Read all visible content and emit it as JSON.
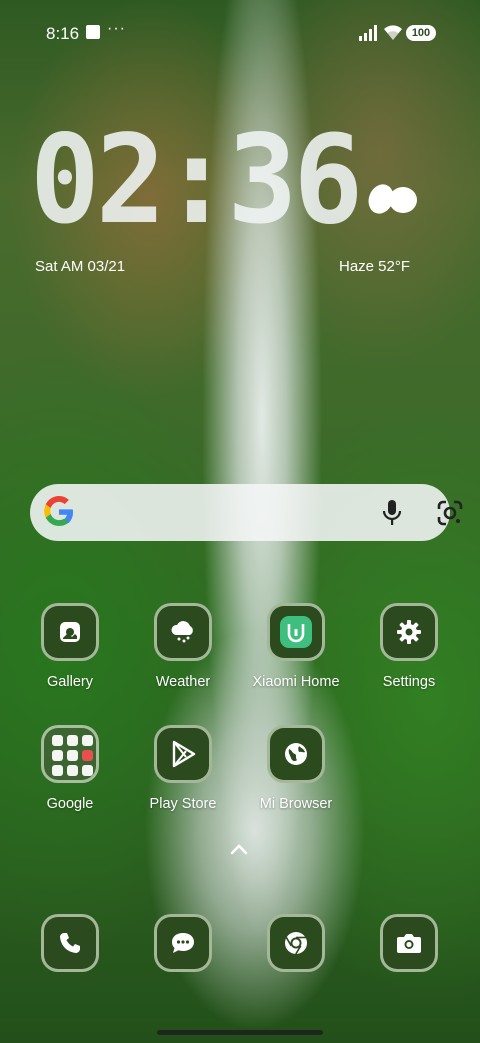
{
  "status_bar": {
    "time": "8:16",
    "overflow": "···",
    "battery": "100",
    "icons": [
      "notification-square-icon",
      "signal-icon",
      "wifi-icon",
      "battery-icon"
    ]
  },
  "clock_widget": {
    "time": "02:36",
    "date": "Sat AM 03/21",
    "weather": "Haze  52°F",
    "weather_icon": "haze-cloud-icon"
  },
  "search": {
    "icons": [
      "google-logo",
      "microphone-icon",
      "google-lens-icon"
    ]
  },
  "apps": [
    {
      "label": "Gallery",
      "icon": "gallery-icon"
    },
    {
      "label": "Weather",
      "icon": "weather-cloud-icon"
    },
    {
      "label": "Xiaomi Home",
      "icon": "xiaomi-home-icon"
    },
    {
      "label": "Settings",
      "icon": "gear-icon"
    },
    {
      "label": "Google",
      "icon": "folder-icon"
    },
    {
      "label": "Play Store",
      "icon": "play-store-icon"
    },
    {
      "label": "Mi Browser",
      "icon": "globe-icon"
    }
  ],
  "dock": [
    {
      "name": "phone",
      "icon": "phone-icon"
    },
    {
      "name": "messages",
      "icon": "message-icon"
    },
    {
      "name": "chrome",
      "icon": "chrome-icon"
    },
    {
      "name": "camera",
      "icon": "camera-icon"
    }
  ],
  "colors": {
    "icon_bg": "#2b4a1e",
    "icon_border": "#cddcc3",
    "xiaomi_green": "#3fbf7f",
    "search_bg": "#f4f6f6"
  }
}
